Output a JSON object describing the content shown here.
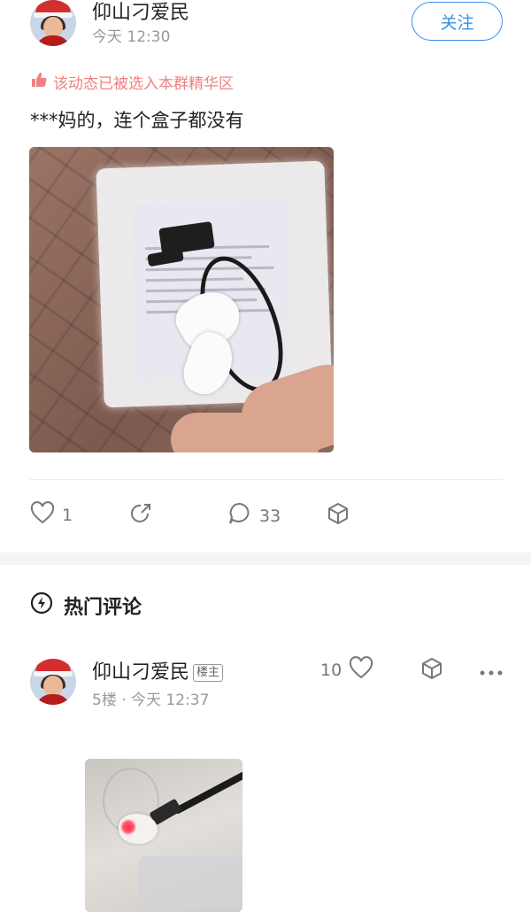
{
  "post": {
    "author": "仰山刁爱民",
    "time": "今天 12:30",
    "follow_label": "关注",
    "featured_text": "该动态已被选入本群精华区",
    "text": "***妈的，连个盒子都没有"
  },
  "actions": {
    "likes": "1",
    "share": "",
    "comments": "33"
  },
  "hot_comments": {
    "title": "热门评论"
  },
  "comment": {
    "author": "仰山刁爱民",
    "badge": "楼主",
    "floor_time": "5楼 · 今天 12:37",
    "likes": "10"
  },
  "icons": {
    "like": "heart-icon",
    "share": "share-icon",
    "comment": "comment-icon",
    "collect": "cube-icon",
    "more": "more-icon",
    "hot": "lightning-icon",
    "thumb": "thumbs-up-icon"
  },
  "colors": {
    "accent": "#3a8ee6",
    "featured": "#f08080"
  }
}
